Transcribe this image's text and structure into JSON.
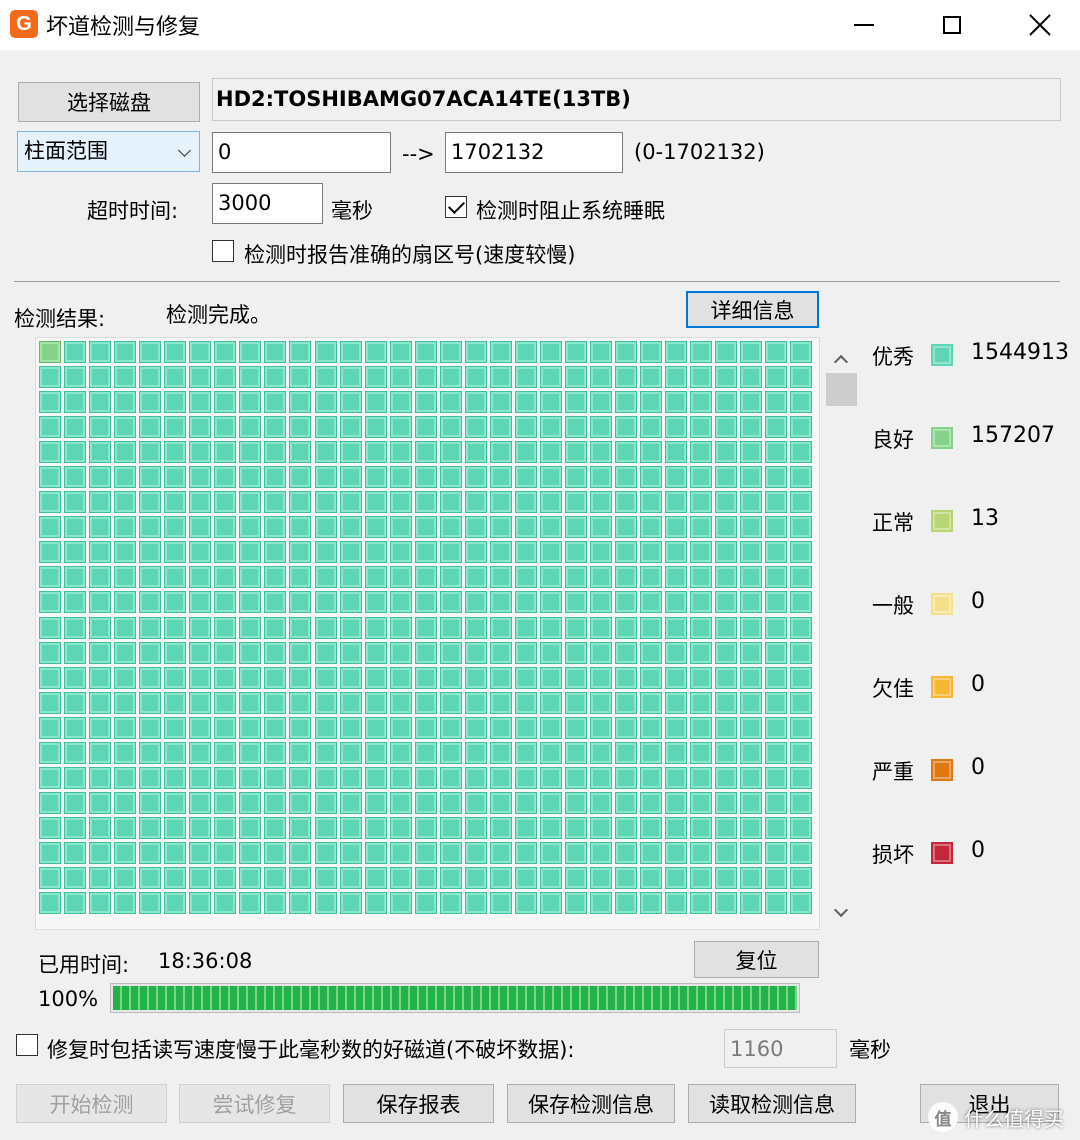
{
  "window": {
    "icon_letter": "G",
    "title": "坏道检测与修复"
  },
  "top": {
    "select_disk_button": "选择磁盘",
    "disk_name": "HD2:TOSHIBAMG07ACA14TE(13TB)",
    "range_mode": "柱面范围",
    "range_start": "0",
    "arrow": "-->",
    "range_end": "1702132",
    "range_total": "(0-1702132)",
    "timeout_label": "超时时间:",
    "timeout_value": "3000",
    "timeout_unit": "毫秒",
    "prevent_sleep_label": "检测时阻止系统睡眠",
    "prevent_sleep_checked": true,
    "report_sector_label": "检测时报告准确的扇区号(速度较慢)",
    "report_sector_checked": false
  },
  "result": {
    "label": "检测结果:",
    "status": "检测完成。",
    "details_button": "详细信息"
  },
  "grid": {
    "columns": 31,
    "rows": 23,
    "good_cells": [
      0
    ]
  },
  "legend": [
    {
      "label": "优秀",
      "value": "1544913",
      "color": "#5ed6b6"
    },
    {
      "label": "良好",
      "value": "157207",
      "color": "#85d389"
    },
    {
      "label": "正常",
      "value": "13",
      "color": "#b7d672"
    },
    {
      "label": "一般",
      "value": "0",
      "color": "#f5e08a"
    },
    {
      "label": "欠佳",
      "value": "0",
      "color": "#f7b634"
    },
    {
      "label": "严重",
      "value": "0",
      "color": "#e0780f"
    },
    {
      "label": "损坏",
      "value": "0",
      "color": "#c3273b"
    }
  ],
  "timing": {
    "elapsed_label": "已用时间:",
    "elapsed_value": "18:36:08",
    "reset_button": "复位",
    "percent": "100%",
    "progress": 1.0
  },
  "repair_option": {
    "label": "修复时包括读写速度慢于此毫秒数的好磁道(不破坏数据):",
    "checked": false,
    "value": "1160",
    "unit": "毫秒"
  },
  "bottom_buttons": {
    "start": "开始检测",
    "try_repair": "尝试修复",
    "save_report": "保存报表",
    "save_info": "保存检测信息",
    "load_info": "读取检测信息",
    "exit": "退出"
  },
  "watermark": {
    "badge": "值",
    "text": "什么值得买"
  }
}
